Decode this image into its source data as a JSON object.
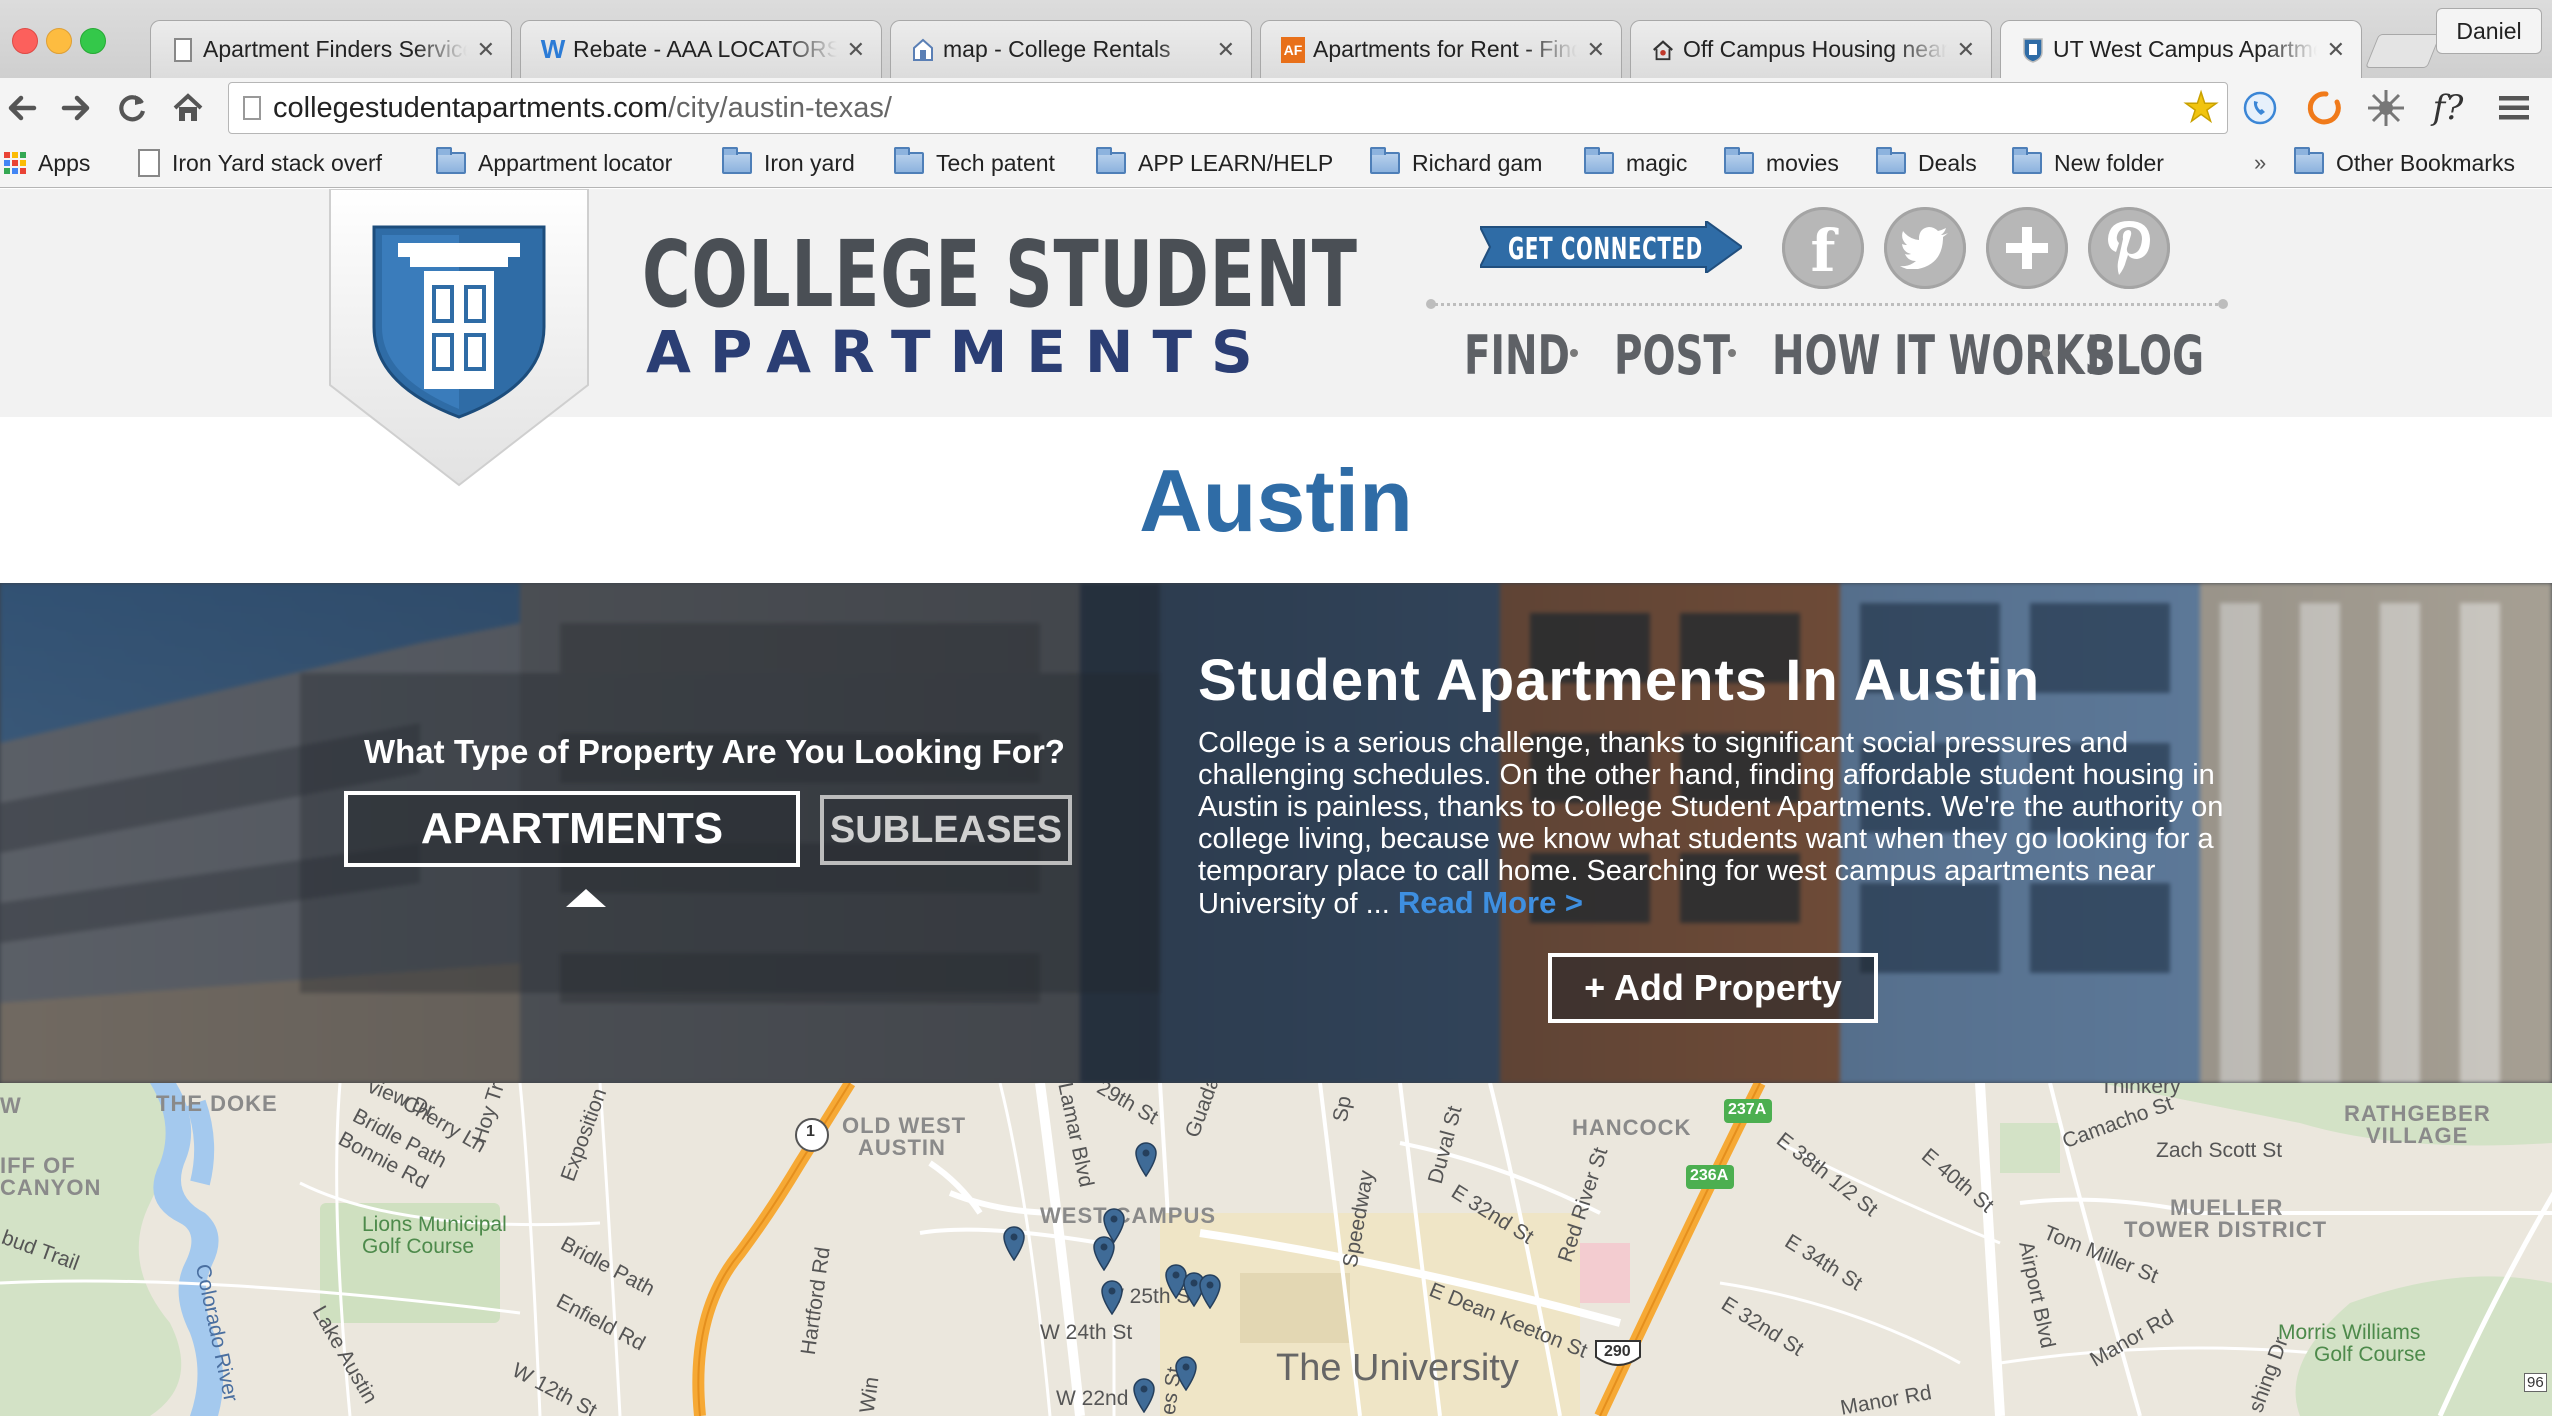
{
  "browser": {
    "tabs": [
      {
        "title": "Apartment Finders Service",
        "icon": "page-icon"
      },
      {
        "title": "Rebate - AAA LOCATORS",
        "icon": "w-logo-icon"
      },
      {
        "title": "map - College Rentals",
        "icon": "house-icon"
      },
      {
        "title": "Apartments for Rent - Find",
        "icon": "af-logo-icon"
      },
      {
        "title": "Off Campus Housing near",
        "icon": "house-people-icon"
      },
      {
        "title": "UT West Campus Apartments",
        "icon": "shield-icon"
      }
    ],
    "profile_name": "Daniel",
    "url_host": "collegestudentapartments.com",
    "url_path": "/city/austin-texas/",
    "bookmarks": [
      {
        "label": "Apps",
        "type": "apps"
      },
      {
        "label": "Iron Yard stack overf",
        "type": "page"
      },
      {
        "label": "Appartment locator",
        "type": "folder"
      },
      {
        "label": "Iron yard",
        "type": "folder"
      },
      {
        "label": "Tech patent",
        "type": "folder"
      },
      {
        "label": "APP LEARN/HELP",
        "type": "folder"
      },
      {
        "label": "Richard gam",
        "type": "folder"
      },
      {
        "label": "magic",
        "type": "folder"
      },
      {
        "label": "movies",
        "type": "folder"
      },
      {
        "label": "Deals",
        "type": "folder"
      },
      {
        "label": "New folder",
        "type": "folder"
      }
    ],
    "overflow_chevron": "»",
    "other_bookmarks": "Other Bookmarks",
    "font_ext_label": "f?"
  },
  "site": {
    "brand_line1": "COLLEGE STUDENT",
    "brand_line2": "APARTMENTS",
    "get_connected": "GET CONNECTED",
    "social": [
      "facebook-icon",
      "twitter-icon",
      "google-plus-icon",
      "pinterest-icon"
    ],
    "nav": [
      "FIND",
      "POST",
      "HOW IT WORKS",
      "BLOG"
    ],
    "city_title": "Austin",
    "colors": {
      "brand_blue": "#2f6ca6",
      "navy": "#2b3e74",
      "link_blue": "#3e8fe0"
    }
  },
  "hero": {
    "question": "What Type of Property Are You Looking For?",
    "option_apartments": "APARTMENTS",
    "option_subleases": "SUBLEASES",
    "selected": "APARTMENTS",
    "title": "Student Apartments In Austin",
    "body": "College is a serious challenge, thanks to significant social pressures and challenging schedules. On the other hand, finding affordable student housing in Austin is painless, thanks to College Student Apartments. We're the authority on college living, because we know what students want when they go looking for a temporary place to call home. Searching for west campus apartments near University of ... ",
    "read_more": "Read More >",
    "add_property": "+ Add Property"
  },
  "map": {
    "labels": {
      "doke": "THE DOKE",
      "canyon1": "IFF OF",
      "canyon2": "CANYON",
      "w": "W",
      "old_west_austin1": "OLD WEST",
      "old_west_austin2": "AUSTIN",
      "west_campus": "WEST CAMPUS",
      "hancock": "HANCOCK",
      "mueller1": "MUELLER",
      "mueller2": "TOWER DISTRICT",
      "rathgeber1": "RATHGEBER",
      "rathgeber2": "VILLAGE",
      "ut": "The University",
      "lions1": "Lions Municipal",
      "lions2": "Golf Course",
      "morris1": "Morris Williams",
      "morris2": "Golf Course",
      "s1": "view Dr",
      "s2": "Bridle Path",
      "s3": "Cherry Ln",
      "s4": "Bonnie Rd",
      "s5": "Exposition",
      "s6": "Hoy Tr",
      "s7": "Lamar Blvd",
      "s8": "29th St",
      "s9": "Guadal",
      "s10": "Duval St",
      "s11": "E 32nd St",
      "s12": "Red River St",
      "s13": "E 38th 1/2 St",
      "s14": "E 40th St",
      "s15": "Camacho St",
      "s16": "Zach Scott St",
      "s17": "Tom Miller St",
      "s18": "E 34th St",
      "s19": "E 32nd St",
      "s20": "E Dean Keeton St",
      "s21": "Speedway",
      "s22": "W 25th St",
      "s23": "W 24th St",
      "s24": "W 22nd",
      "s25": "Hartford Rd",
      "s26": "Enfield Rd",
      "s27": "Bridle Path",
      "s28": "Lake Austin",
      "s29": "Colorado River",
      "s30": "W 12th St",
      "s31": "Airport Blvd",
      "s32": "Manor Rd",
      "s33": "Manor Rd",
      "s34": "bud Trail",
      "s35": "Win",
      "s36": "es St",
      "s37": "shing Dr",
      "s38": "Sp",
      "s39": "Thinkery",
      "hw1": "1",
      "hw237": "237A",
      "hw236": "236A",
      "hw290": "290",
      "corner": "96"
    }
  }
}
